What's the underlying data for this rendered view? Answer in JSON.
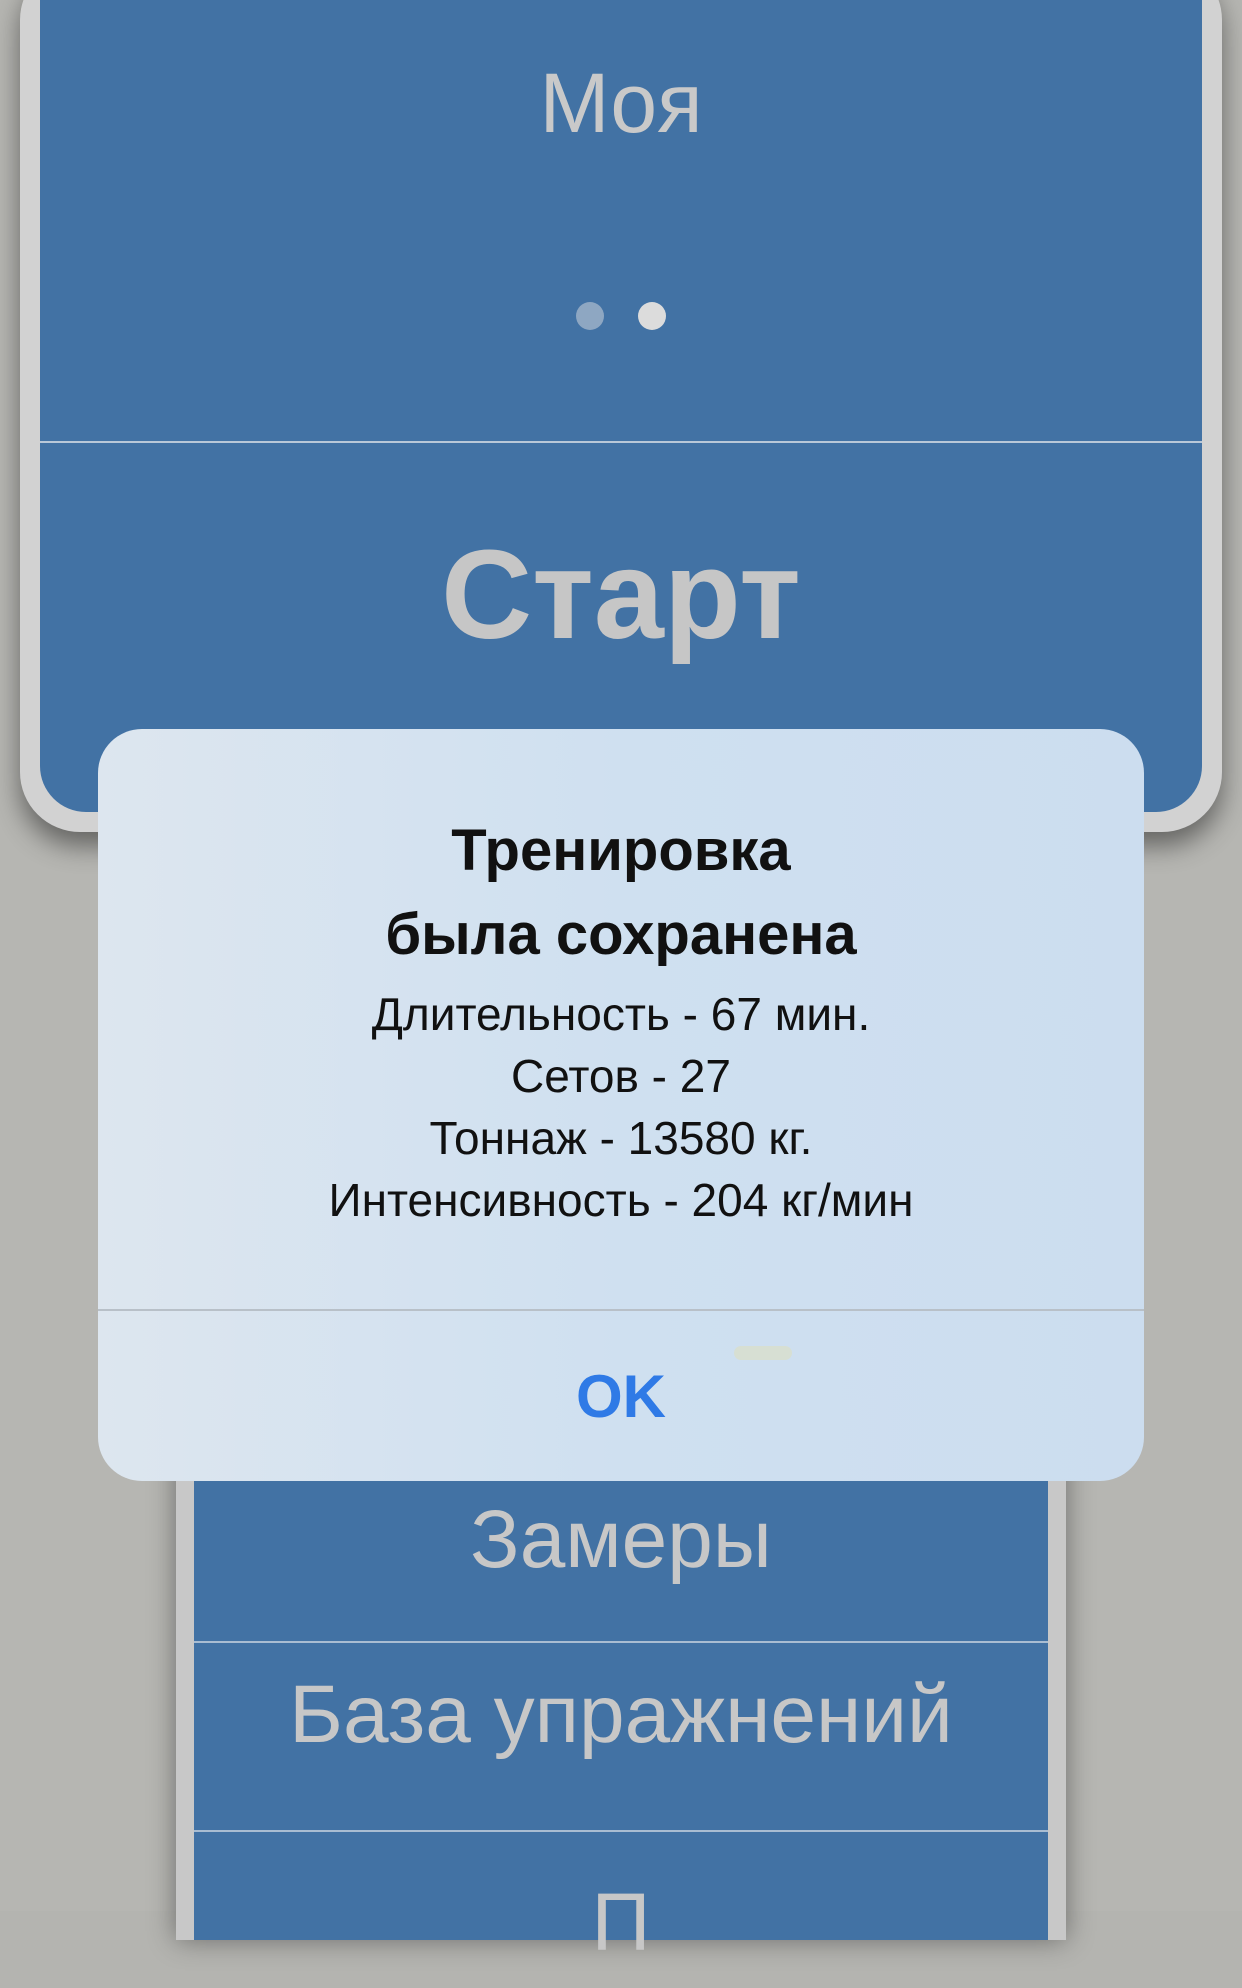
{
  "top_card": {
    "program_name": "Моя",
    "page_indicator": {
      "count": 2,
      "active_index": 1
    },
    "start_label": "Старт"
  },
  "menu": {
    "items": [
      {
        "label": "Замеры"
      },
      {
        "label": "База упражнений"
      },
      {
        "label": "П"
      }
    ]
  },
  "alert": {
    "title_line1": "Тренировка",
    "title_line2": "была сохранена",
    "lines": [
      "Длительность - 67 мин.",
      "Сетов - 27",
      "Тоннаж - 13580 кг.",
      "Интенсивность - 204 кг/мин"
    ],
    "ok_label": "OK"
  },
  "colors": {
    "card_blue": "#4272a4",
    "ok_blue": "#2f7ae6",
    "background_dim": "#b6b6b2"
  }
}
